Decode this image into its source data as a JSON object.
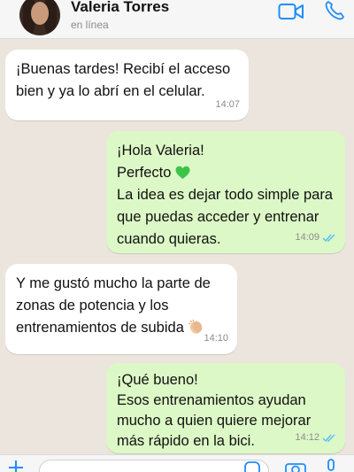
{
  "header": {
    "contact_name": "Valeria Torres",
    "status": "en línea",
    "icons": [
      "video-call-icon",
      "phone-call-icon"
    ]
  },
  "messages": [
    {
      "direction": "in",
      "text": "¡Buenas tardes! Recibí el acceso\nbien y ya lo abrí en el celular.",
      "time": "14:07"
    },
    {
      "direction": "out",
      "text_parts": [
        "¡Hola Valeria!",
        "Perfecto",
        "La idea es dejar todo simple para\nque puedas acceder y entrenar\ncuando quieras."
      ],
      "emoji": "green-heart",
      "time": "14:09",
      "read": true
    },
    {
      "direction": "in",
      "text": "Y me gustó mucho la parte de\nzonas de potencia y los\nentrenamientos de subida",
      "emoji": "clapping-hands",
      "time": "14:10"
    },
    {
      "direction": "out",
      "text": "¡Qué bueno!\nEsos entrenamientos ayudan\nmucho a quien quiere mejorar\nmás rápido en la bici.",
      "time": "14:12",
      "read": true
    }
  ],
  "input_bar": {
    "placeholder": "",
    "icons": [
      "plus-icon",
      "sticker-icon",
      "camera-icon",
      "microphone-icon"
    ]
  },
  "colors": {
    "chat_background": "#ece5dd",
    "incoming_bubble": "#ffffff",
    "outgoing_bubble": "#dcf8c6",
    "accent_blue": "#1f8efa",
    "read_ticks": "#4fc3f7"
  }
}
